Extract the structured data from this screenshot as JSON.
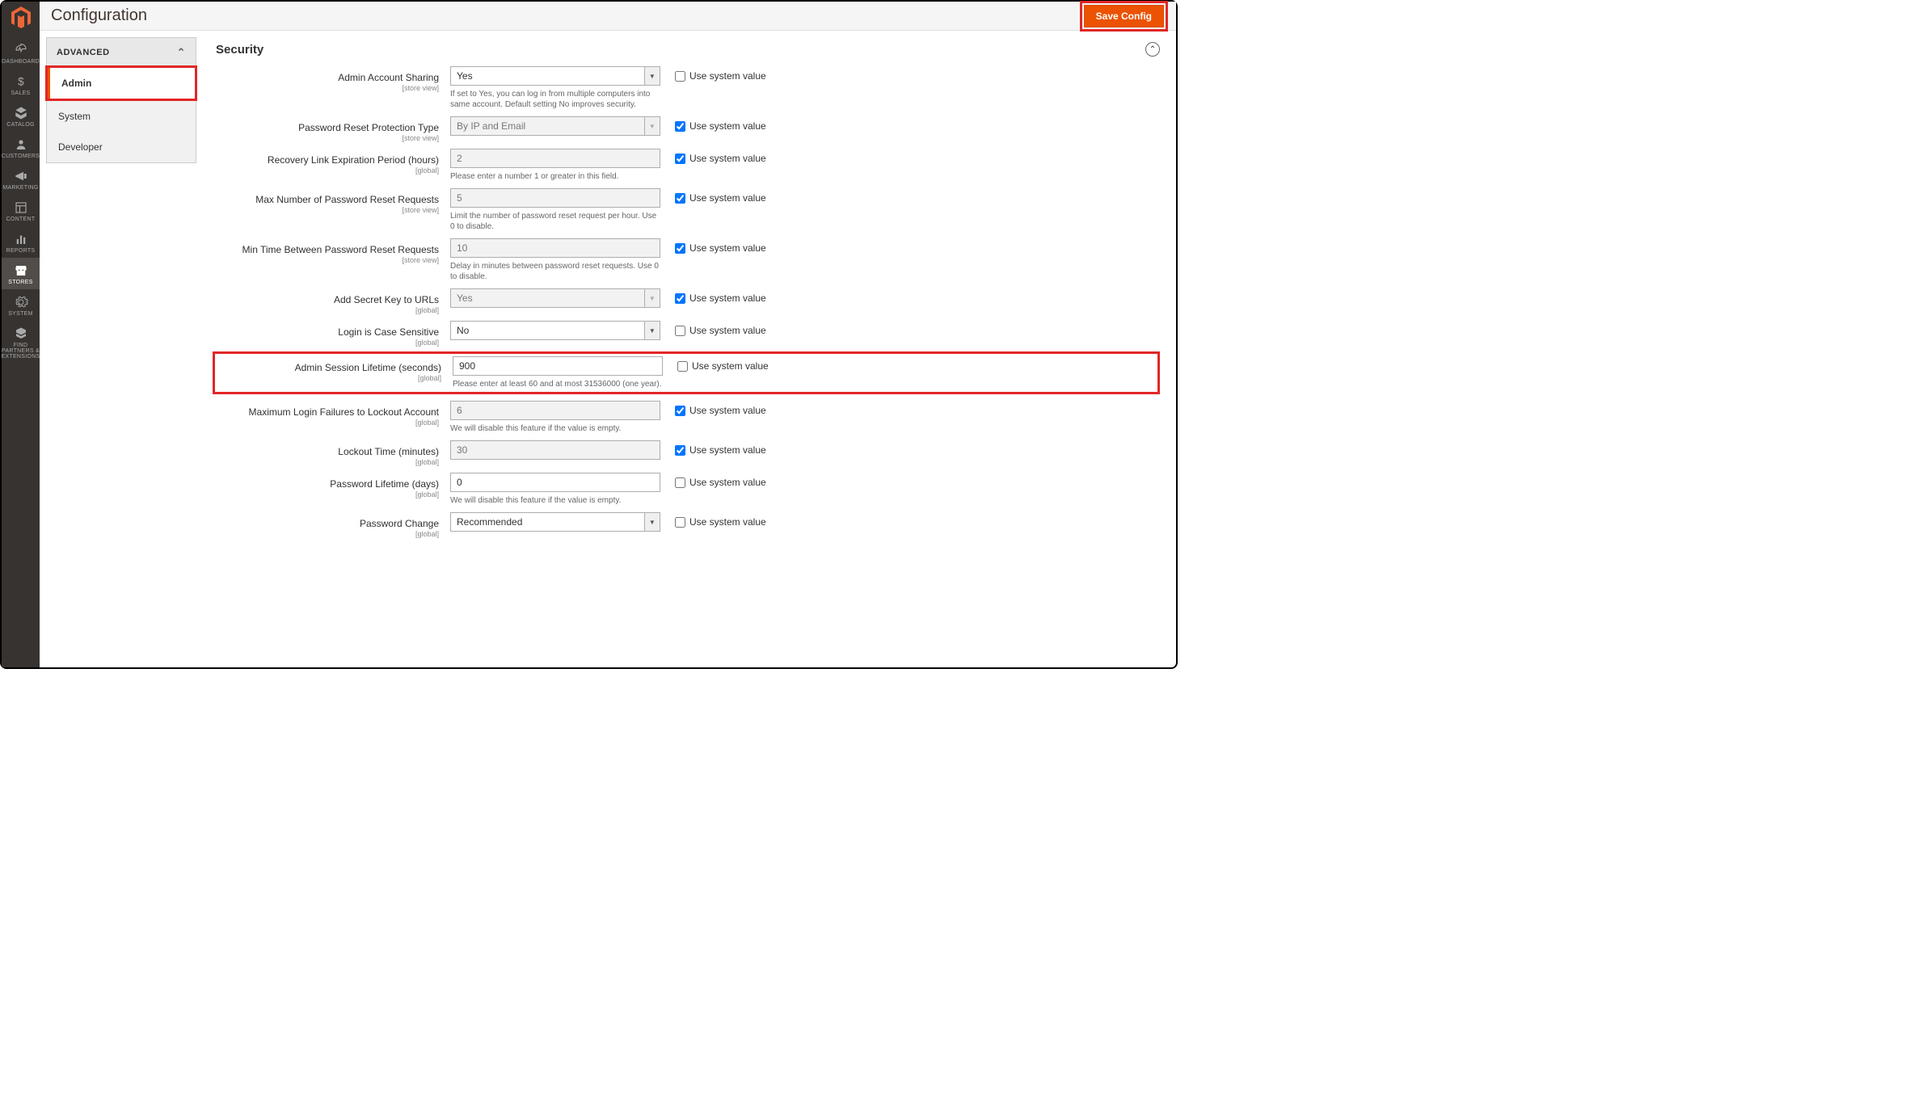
{
  "page": {
    "title": "Configuration",
    "saveLabel": "Save Config"
  },
  "sidebar": {
    "items": [
      {
        "label": "DASHBOARD"
      },
      {
        "label": "SALES"
      },
      {
        "label": "CATALOG"
      },
      {
        "label": "CUSTOMERS"
      },
      {
        "label": "MARKETING"
      },
      {
        "label": "CONTENT"
      },
      {
        "label": "REPORTS"
      },
      {
        "label": "STORES"
      },
      {
        "label": "SYSTEM"
      },
      {
        "label": "FIND PARTNERS & EXTENSIONS"
      }
    ]
  },
  "configNav": {
    "section": "ADVANCED",
    "items": [
      {
        "label": "Admin",
        "active": true
      },
      {
        "label": "System"
      },
      {
        "label": "Developer"
      }
    ]
  },
  "section": {
    "title": "Security"
  },
  "labels": {
    "useSystem": "Use system value"
  },
  "fields": {
    "sharing": {
      "label": "Admin Account Sharing",
      "scope": "[store view]",
      "value": "Yes",
      "note": "If set to Yes, you can log in from multiple computers into same account. Default setting No improves security.",
      "useSystem": false,
      "disabled": false,
      "type": "select"
    },
    "protType": {
      "label": "Password Reset Protection Type",
      "scope": "[store view]",
      "value": "By IP and Email",
      "useSystem": true,
      "disabled": true,
      "type": "select"
    },
    "recovery": {
      "label": "Recovery Link Expiration Period (hours)",
      "scope": "[global]",
      "value": "2",
      "note": "Please enter a number 1 or greater in this field.",
      "useSystem": true,
      "disabled": true,
      "type": "text"
    },
    "maxReq": {
      "label": "Max Number of Password Reset Requests",
      "scope": "[store view]",
      "value": "5",
      "note": "Limit the number of password reset request per hour. Use 0 to disable.",
      "useSystem": true,
      "disabled": true,
      "type": "text"
    },
    "minTime": {
      "label": "Min Time Between Password Reset Requests",
      "scope": "[store view]",
      "value": "10",
      "note": "Delay in minutes between password reset requests. Use 0 to disable.",
      "useSystem": true,
      "disabled": true,
      "type": "text"
    },
    "secretKey": {
      "label": "Add Secret Key to URLs",
      "scope": "[global]",
      "value": "Yes",
      "useSystem": true,
      "disabled": true,
      "type": "select"
    },
    "caseSens": {
      "label": "Login is Case Sensitive",
      "scope": "[global]",
      "value": "No",
      "useSystem": false,
      "disabled": false,
      "type": "select"
    },
    "session": {
      "label": "Admin Session Lifetime (seconds)",
      "scope": "[global]",
      "value": "900",
      "note": "Please enter at least 60 and at most 31536000 (one year).",
      "useSystem": false,
      "disabled": false,
      "type": "text"
    },
    "maxFail": {
      "label": "Maximum Login Failures to Lockout Account",
      "scope": "[global]",
      "value": "6",
      "note": "We will disable this feature if the value is empty.",
      "useSystem": true,
      "disabled": true,
      "type": "text"
    },
    "lockTime": {
      "label": "Lockout Time (minutes)",
      "scope": "[global]",
      "value": "30",
      "useSystem": true,
      "disabled": true,
      "type": "text"
    },
    "pwdLife": {
      "label": "Password Lifetime (days)",
      "scope": "[global]",
      "value": "0",
      "note": "We will disable this feature if the value is empty.",
      "useSystem": false,
      "disabled": false,
      "type": "text"
    },
    "pwdChange": {
      "label": "Password Change",
      "scope": "[global]",
      "value": "Recommended",
      "useSystem": false,
      "disabled": false,
      "type": "select"
    }
  }
}
